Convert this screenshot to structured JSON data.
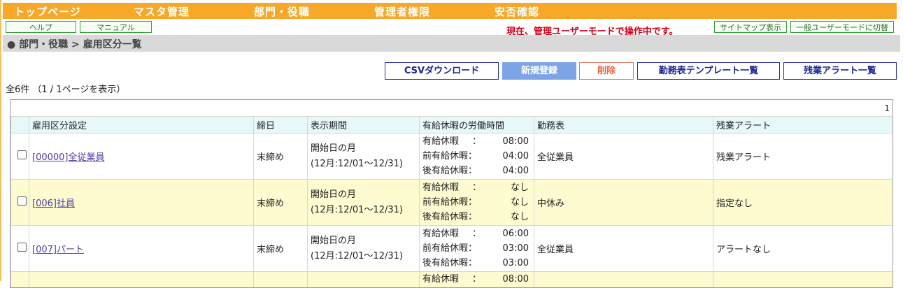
{
  "nav": [
    "トップページ",
    "マスタ管理",
    "部門・役職",
    "管理者権限",
    "安否確認"
  ],
  "help_label": "ヘルプ",
  "manual_label": "マニュアル",
  "mode_message": "現在、管理ユーザーモードで操作中です。",
  "sitemap_label": "サイトマップ表示",
  "usermode_label": "一般ユーザーモードに切替",
  "breadcrumb": "● 部門・役職 > 雇用区分一覧",
  "actions": {
    "csv": "CSVダウンロード",
    "new": "新規登録",
    "delete": "削除",
    "templates": "勤務表テンプレート一覧",
    "overtime": "残業アラート一覧"
  },
  "summary": "全6件 （1 / 1ページを表示）",
  "pager": "1",
  "columns": [
    "雇用区分設定",
    "締日",
    "表示期間",
    "有給休暇の労働時間",
    "勤務表",
    "残業アラート"
  ],
  "rows": [
    {
      "name": "[00000]全従業員",
      "close": "末締め",
      "period1": "開始日の月",
      "period2": "(12月:12/01～12/31)",
      "hours": [
        {
          "label": "有給休暇",
          "colon": "：",
          "value": "08:00"
        },
        {
          "label": "前有給休暇：",
          "colon": "",
          "value": "04:00"
        },
        {
          "label": "後有給休暇：",
          "colon": "",
          "value": "04:00"
        }
      ],
      "schedule": "全従業員",
      "alert": "残業アラート"
    },
    {
      "name": "[006]社員",
      "close": "末締め",
      "period1": "開始日の月",
      "period2": "(12月:12/01～12/31)",
      "hours": [
        {
          "label": "有給休暇",
          "colon": "：",
          "value": "なし"
        },
        {
          "label": "前有給休暇：",
          "colon": "",
          "value": "なし"
        },
        {
          "label": "後有給休暇：",
          "colon": "",
          "value": "なし"
        }
      ],
      "schedule": "中休み",
      "alert": "指定なし"
    },
    {
      "name": "[007]パート",
      "close": "末締め",
      "period1": "開始日の月",
      "period2": "(12月:12/01～12/31)",
      "hours": [
        {
          "label": "有給休暇",
          "colon": "：",
          "value": "06:00"
        },
        {
          "label": "前有給休暇：",
          "colon": "",
          "value": "03:00"
        },
        {
          "label": "後有給休暇：",
          "colon": "",
          "value": "03:00"
        }
      ],
      "schedule": "全従業員",
      "alert": "アラートなし"
    },
    {
      "name": "",
      "close": "",
      "period1": "",
      "period2": "",
      "hours": [
        {
          "label": "有給休暇",
          "colon": "：",
          "value": "08:00"
        }
      ],
      "schedule": "",
      "alert": ""
    }
  ]
}
